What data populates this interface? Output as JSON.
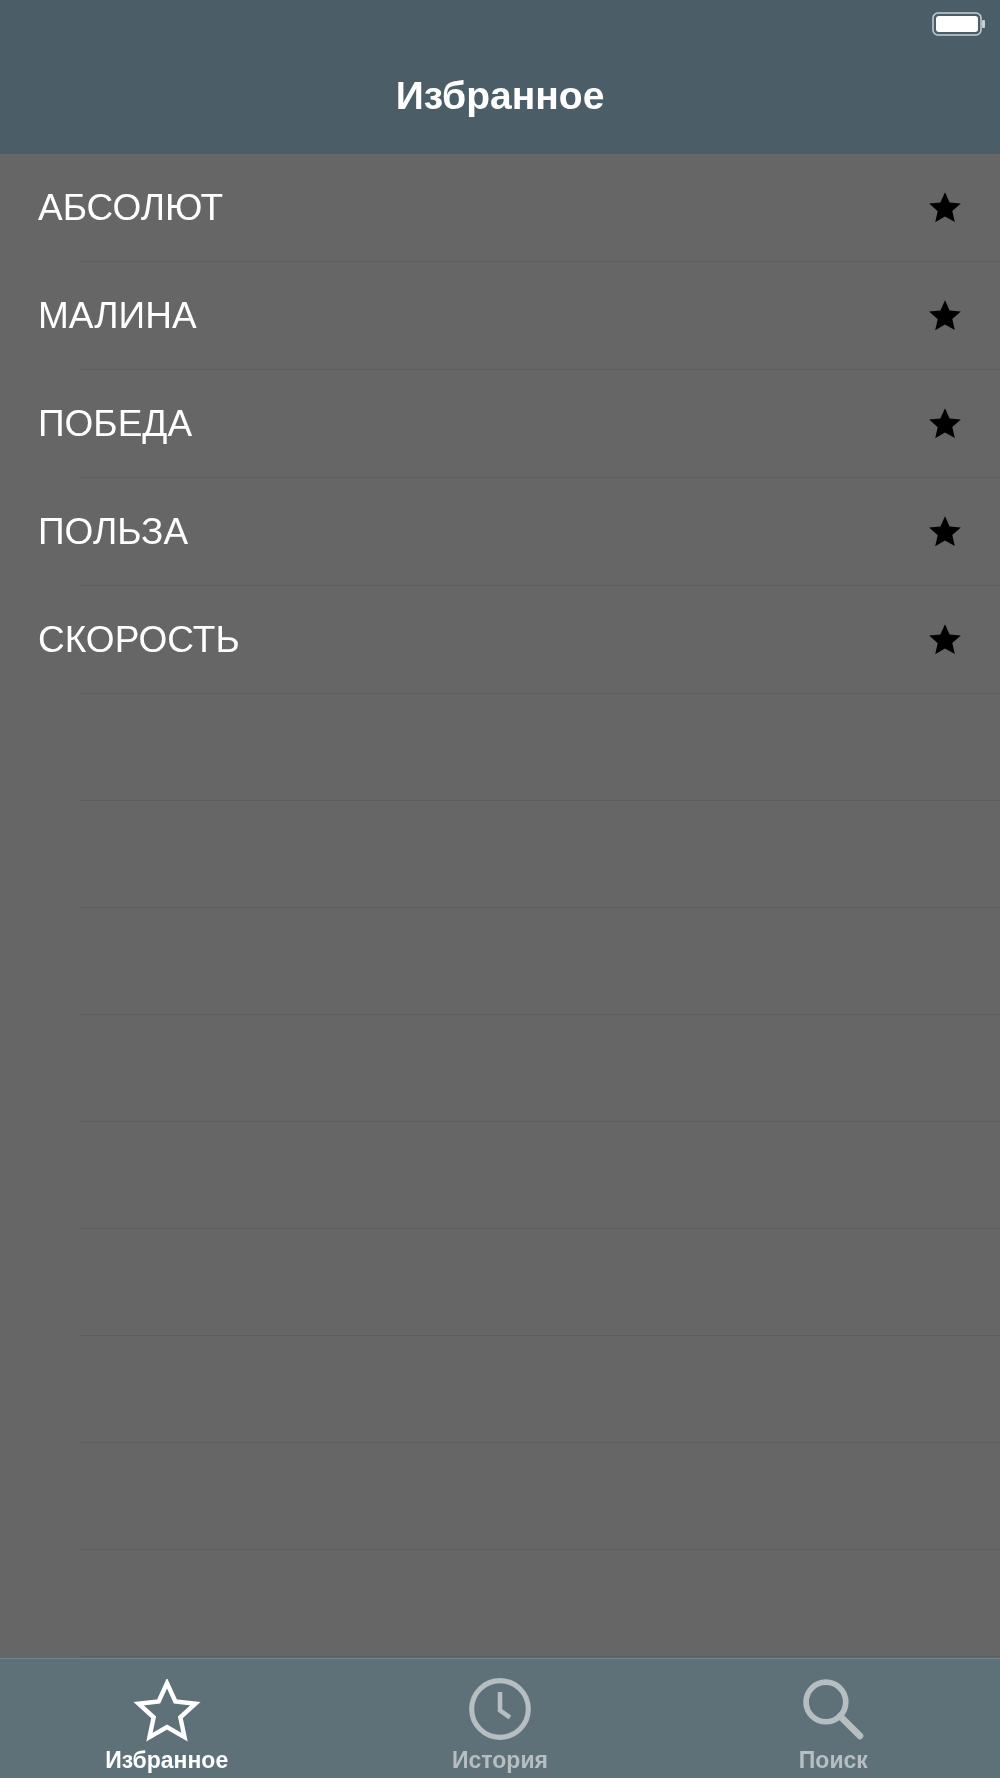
{
  "header": {
    "title": "Избранное"
  },
  "items": [
    {
      "word": "АБСОЛЮТ",
      "favorite": true
    },
    {
      "word": "МАЛИНА",
      "favorite": true
    },
    {
      "word": "ПОБЕДА",
      "favorite": true
    },
    {
      "word": "ПОЛЬЗА",
      "favorite": true
    },
    {
      "word": "СКОРОСТЬ",
      "favorite": true
    }
  ],
  "tabs": [
    {
      "kind": "star",
      "label": "Избранное",
      "selected": true
    },
    {
      "kind": "clock",
      "label": "История",
      "selected": false
    },
    {
      "kind": "search",
      "label": "Поиск",
      "selected": false
    }
  ]
}
